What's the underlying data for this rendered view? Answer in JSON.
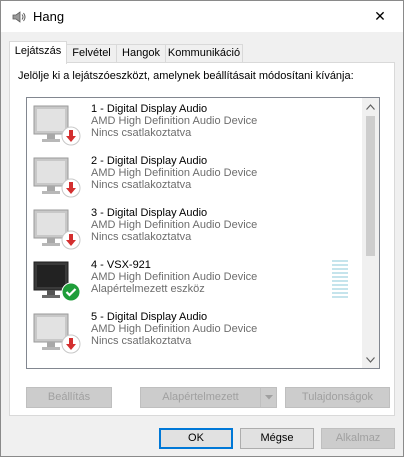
{
  "window": {
    "title": "Hang",
    "close_glyph": "✕"
  },
  "tabs": [
    {
      "label": "Lejátszás",
      "active": true
    },
    {
      "label": "Felvétel",
      "active": false
    },
    {
      "label": "Hangok",
      "active": false
    },
    {
      "label": "Kommunikáció",
      "active": false
    }
  ],
  "instruction": "Jelölje ki a lejátszóeszközt, amelynek beállításait módosítani kívánja:",
  "devices": [
    {
      "name": "1 - Digital Display Audio",
      "description": "AMD High Definition Audio Device",
      "status": "Nincs csatlakoztatva",
      "icon": "monitor-disconnected-icon"
    },
    {
      "name": "2 - Digital Display Audio",
      "description": "AMD High Definition Audio Device",
      "status": "Nincs csatlakoztatva",
      "icon": "monitor-disconnected-icon"
    },
    {
      "name": "3 - Digital Display Audio",
      "description": "AMD High Definition Audio Device",
      "status": "Nincs csatlakoztatva",
      "icon": "monitor-disconnected-icon"
    },
    {
      "name": "4 - VSX-921",
      "description": "AMD High Definition Audio Device",
      "status": "Alapértelmezett eszköz",
      "icon": "monitor-default-icon"
    },
    {
      "name": "5 - Digital Display Audio",
      "description": "AMD High Definition Audio Device",
      "status": "Nincs csatlakoztatva",
      "icon": "monitor-disconnected-icon"
    }
  ],
  "panel_buttons": {
    "configure": "Beállítás",
    "set_default": "Alapértelmezett",
    "properties": "Tulajdonságok"
  },
  "dialog_buttons": {
    "ok": "OK",
    "cancel": "Mégse",
    "apply": "Alkalmaz"
  },
  "colors": {
    "disconnected_badge": "#d32f2f",
    "default_badge": "#1f9e3a",
    "focus_border": "#0078d7"
  }
}
